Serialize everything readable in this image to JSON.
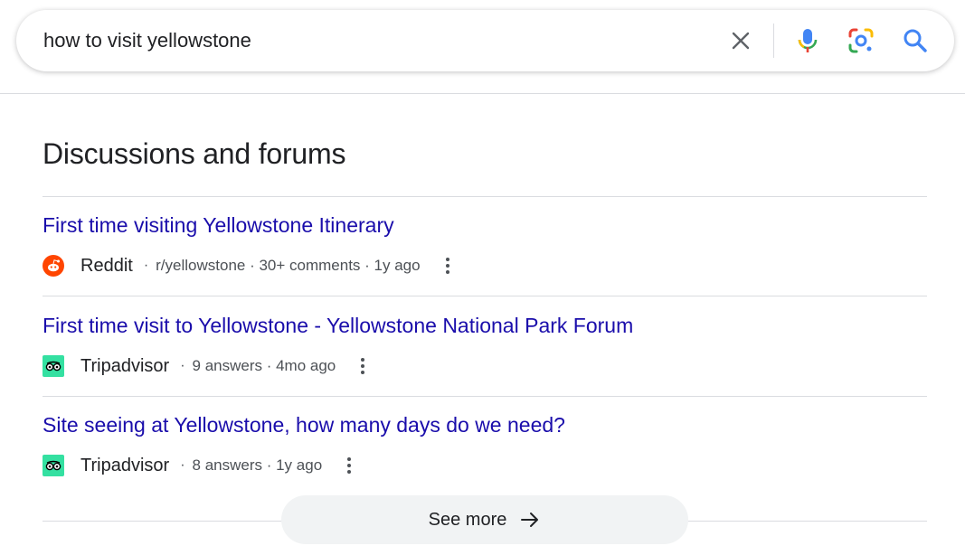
{
  "search": {
    "query": "how to visit yellowstone"
  },
  "icons": {
    "clear": "close-icon",
    "mic": "microphone-icon",
    "lens": "lens-icon",
    "search": "search-icon"
  },
  "section": {
    "title": "Discussions and forums"
  },
  "results": [
    {
      "title": "First time visiting Yellowstone Itinerary",
      "source": "Reddit",
      "meta": "r/yellowstone · 30+ comments · 1y ago",
      "favicon": "reddit-icon"
    },
    {
      "title": "First time visit to Yellowstone - Yellowstone National Park Forum",
      "source": "Tripadvisor",
      "meta": "9 answers · 4mo ago",
      "favicon": "tripadvisor-icon"
    },
    {
      "title": "Site seeing at Yellowstone, how many days do we need?",
      "source": "Tripadvisor",
      "meta": "8 answers · 1y ago",
      "favicon": "tripadvisor-icon"
    }
  ],
  "see_more": {
    "label": "See more"
  },
  "colors": {
    "link": "#1a0dab",
    "reddit": "#ff4500",
    "tripadvisor": "#34e0a1",
    "search_blue": "#4285f4"
  }
}
